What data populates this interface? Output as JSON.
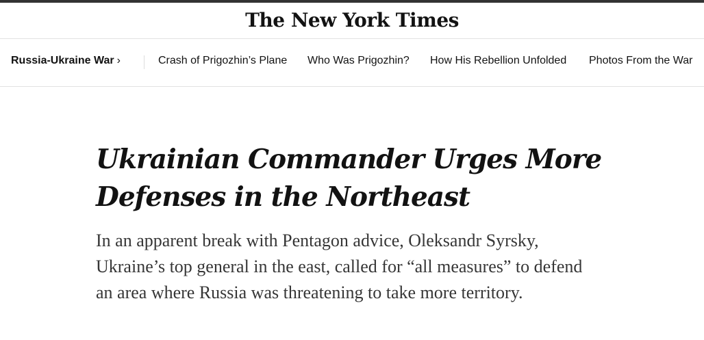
{
  "masthead": {
    "logo_text": "The New York Times"
  },
  "subnav": {
    "section_label": "Russia-Ukraine War",
    "section_chevron": "›",
    "links": [
      {
        "label": "Crash of Prigozhin’s Plane"
      },
      {
        "label": "Who Was Prigozhin?"
      },
      {
        "label": "How His Rebellion Unfolded"
      },
      {
        "label": "Photos From the War"
      }
    ]
  },
  "article": {
    "headline": "Ukrainian Commander Urges More Defenses in the Northeast",
    "summary": "In an apparent break with Pentagon advice, Oleksandr Syrsky, Ukraine’s top general in the east, called for “all measures” to defend an area where Russia was threatening to take more territory."
  },
  "colors": {
    "text": "#121212",
    "summary_text": "#363636",
    "divider": "#e2e2e2",
    "top_border": "#333333"
  }
}
